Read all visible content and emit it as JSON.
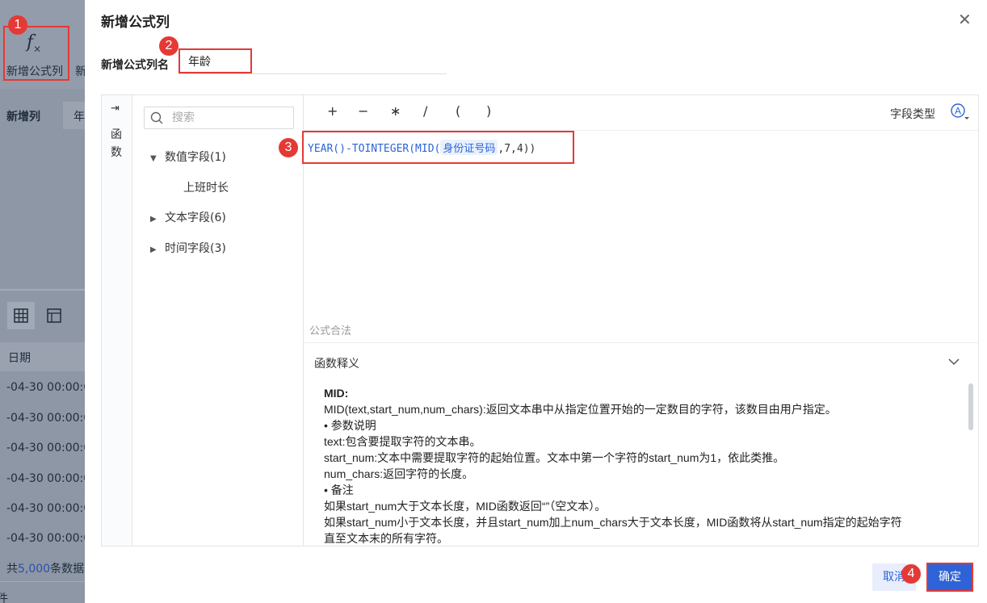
{
  "background": {
    "fx_label": "新增公式列",
    "fx_label_cut": "新",
    "add_col_label": "新增列",
    "add_col_cut": "年",
    "date_header": "日期",
    "rows": [
      "-04-30 00:00:0",
      "-04-30 00:00:0",
      "-04-30 00:00:0",
      "-04-30 00:00:0",
      "-04-30 00:00:0",
      "-04-30 00:00:0"
    ],
    "footer_prefix": "共",
    "footer_count": "5,000",
    "footer_suffix": "条数据",
    "footer_cut": "件"
  },
  "badges": [
    "1",
    "2",
    "3",
    "4"
  ],
  "dialog": {
    "title": "新增公式列",
    "name_label": "新增公式列名",
    "name_value": "年龄"
  },
  "sidebar": {
    "vertical_label": "函数",
    "search_placeholder": "搜索",
    "tree": [
      {
        "label": "数值字段(1)",
        "expanded": true,
        "children": [
          "上班时长"
        ]
      },
      {
        "label": "文本字段(6)",
        "expanded": false
      },
      {
        "label": "时间字段(3)",
        "expanded": false
      }
    ]
  },
  "toolbar": {
    "operators": [
      "+",
      "−",
      "∗",
      "/",
      "(",
      ")"
    ],
    "field_type_label": "字段类型"
  },
  "formula": {
    "part1": "YEAR()-TOINTEGER(MID(",
    "field": "身份证号码",
    "part2": ",7,4))"
  },
  "legal_text": "公式合法",
  "explain": {
    "header": "函数释义",
    "func_name": "MID:",
    "lines": [
      "MID(text,start_num,num_chars):返回文本串中从指定位置开始的一定数目的字符，该数目由用户指定。",
      "• 参数说明",
      "text:包含要提取字符的文本串。",
      "start_num:文本中需要提取字符的起始位置。文本中第一个字符的start_num为1，依此类推。",
      "num_chars:返回字符的长度。",
      "• 备注",
      "如果start_num大于文本长度，MID函数返回“”（空文本）。",
      "如果start_num小于文本长度，并且start_num加上num_chars大于文本长度，MID函数将从start_num指定的起始字符",
      "直至文本末的所有字符。"
    ]
  },
  "buttons": {
    "cancel": "取消",
    "ok": "确定"
  },
  "colors": {
    "accent": "#2e63d8",
    "highlight": "#e53935",
    "overlay": "#8e97a6"
  }
}
